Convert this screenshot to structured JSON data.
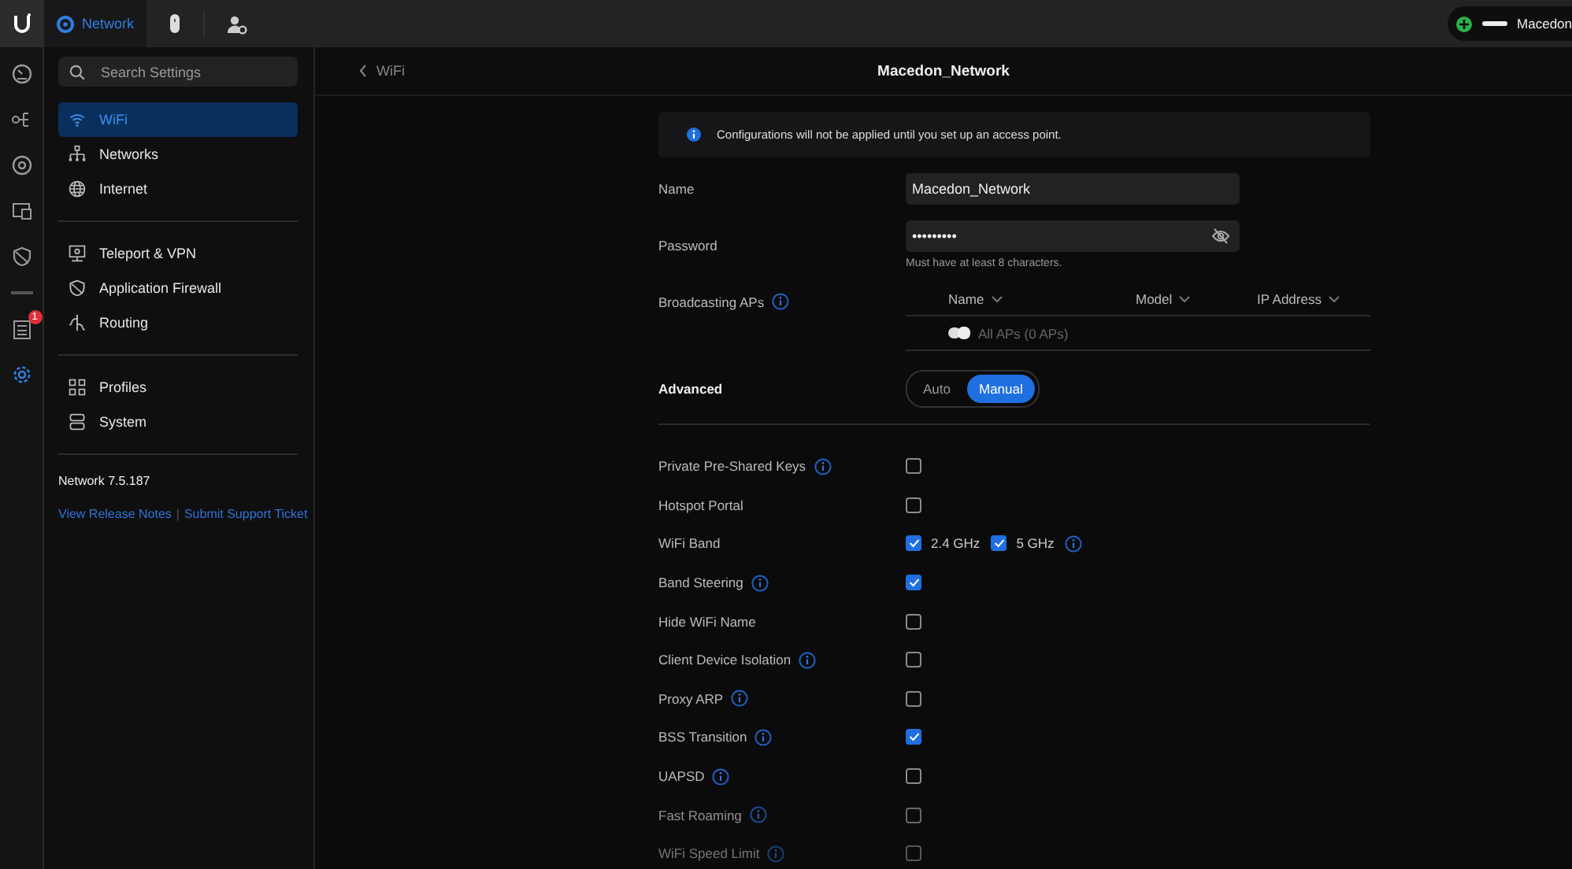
{
  "topbar": {
    "app_tabs": [
      {
        "label": "Network",
        "selected": true
      }
    ],
    "account": {
      "name": "Macedon"
    }
  },
  "rail": {
    "items": [
      {
        "selected": false
      },
      {
        "selected": false
      },
      {
        "selected": false
      },
      {
        "selected": false
      },
      {
        "selected": false
      },
      {
        "selected": false,
        "badge": "1"
      },
      {
        "selected": true
      }
    ]
  },
  "sidebar": {
    "search": {
      "placeholder": "Search Settings"
    },
    "groups": [
      [
        {
          "label": "WiFi",
          "selected": true
        },
        {
          "label": "Networks",
          "selected": false
        },
        {
          "label": "Internet",
          "selected": false
        }
      ],
      [
        {
          "label": "Teleport & VPN",
          "selected": false
        },
        {
          "label": "Application Firewall",
          "selected": false
        },
        {
          "label": "Routing",
          "selected": false
        }
      ],
      [
        {
          "label": "Profiles",
          "selected": false
        },
        {
          "label": "System",
          "selected": false
        }
      ]
    ],
    "version": "Network 7.5.187",
    "links": [
      "View Release Notes",
      "Submit Support Ticket"
    ],
    "link_separator": "|"
  },
  "header": {
    "back": "WiFi",
    "title": "Macedon_Network"
  },
  "notice": "Configurations will not be applied until you set up an access point.",
  "name_field": {
    "label": "Name",
    "value": "Macedon_Network"
  },
  "password_field": {
    "label": "Password",
    "value": "•••••••••",
    "hint": "Must have at least 8 characters."
  },
  "broadcasting_aps": {
    "label": "Broadcasting APs",
    "columns": [
      "Name",
      "Model",
      "IP Address"
    ],
    "rows": [
      {
        "name": "All APs (0 APs)"
      }
    ]
  },
  "advanced": {
    "label": "Advanced",
    "options": [
      {
        "label": "Auto",
        "selected": false
      },
      {
        "label": "Manual",
        "selected": true
      }
    ]
  },
  "settings": [
    {
      "kind": "checkbox",
      "label": "Private Pre-Shared Keys",
      "info": true,
      "checked": false
    },
    {
      "kind": "checkbox",
      "label": "Hotspot Portal",
      "info": false,
      "checked": false
    },
    {
      "kind": "bands",
      "label": "WiFi Band",
      "info": false,
      "bands": [
        {
          "label": "2.4 GHz",
          "checked": true
        },
        {
          "label": "5 GHz",
          "checked": true
        }
      ]
    },
    {
      "kind": "checkbox",
      "label": "Band Steering",
      "info": true,
      "checked": true
    },
    {
      "kind": "checkbox",
      "label": "Hide WiFi Name",
      "info": false,
      "checked": false
    },
    {
      "kind": "checkbox",
      "label": "Client Device Isolation",
      "info": true,
      "checked": false
    },
    {
      "kind": "checkbox",
      "label": "Proxy ARP",
      "info": true,
      "checked": false
    },
    {
      "kind": "checkbox",
      "label": "BSS Transition",
      "info": true,
      "checked": true
    },
    {
      "kind": "checkbox",
      "label": "UAPSD",
      "info": true,
      "checked": false
    },
    {
      "kind": "checkbox",
      "label": "Fast Roaming",
      "info": true,
      "checked": false
    },
    {
      "kind": "checkbox",
      "label": "WiFi Speed Limit",
      "info": true,
      "checked": false
    }
  ]
}
